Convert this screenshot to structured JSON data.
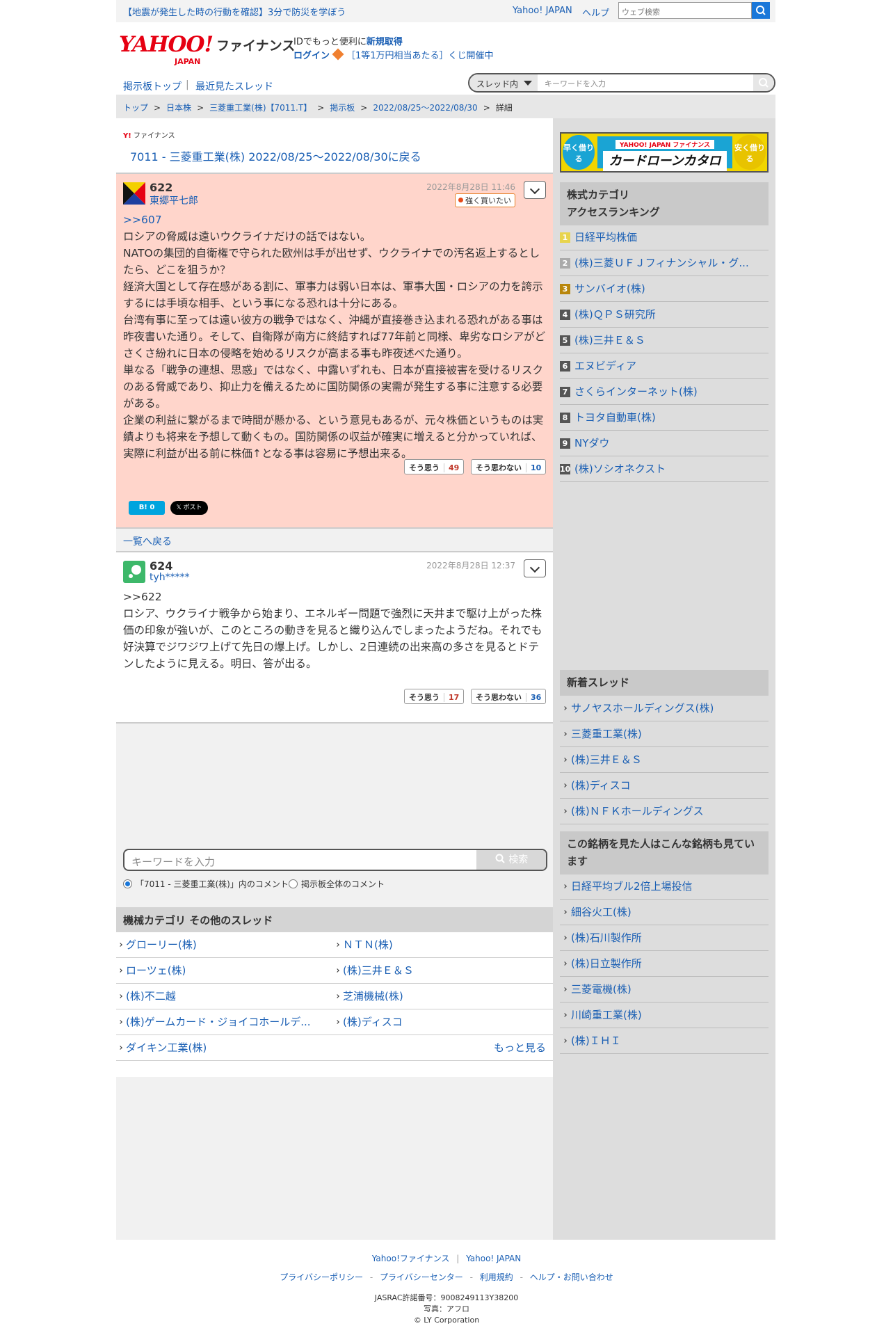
{
  "top": {
    "alert": "【地震が発生した時の行動を確認】3分で防災を学ぼう",
    "yahoo_japan": "Yahoo! JAPAN",
    "help": "ヘルプ",
    "web_search_placeholder": "ウェブ検索"
  },
  "header": {
    "logo": "YAHOO!",
    "logo_sub": "JAPAN",
    "service": "ファイナンス",
    "id_text": "IDでもっと便利に",
    "id_link": "新規取得",
    "login": "ログイン",
    "lottery": "［1等1万円相当あたる］くじ開催中"
  },
  "boardnav": {
    "top": "掲示板トップ",
    "sep": "|",
    "recent": "最近見たスレッド",
    "scope": "スレッド内",
    "keyword_placeholder": "キーワードを入力"
  },
  "breadcrumb": [
    "トップ",
    "日本株",
    "三菱重工業(株)【7011.T】",
    "掲示板",
    "2022/08/25〜2022/08/30",
    "詳細"
  ],
  "thread": {
    "small_logo": "ファイナンス",
    "back": "7011 - 三菱重工業(株) 2022/08/25〜2022/08/30に戻る"
  },
  "posts": [
    {
      "number": "622",
      "user": "東郷平七郎",
      "date": "2022年8月28日 11:46",
      "badge": "強く買いたい",
      "reply": ">>607",
      "lines": [
        "ロシアの脅威は遠いウクライナだけの話ではない。",
        "NATOの集団的自衛権で守られた欧州は手が出せず、ウクライナでの汚名返上するとしたら、どこを狙うか？",
        "経済大国として存在感がある割に、軍事力は弱い日本は、軍事大国・ロシアの力を誇示するには手頃な相手、という事になる恐れは十分にある。",
        "台湾有事に至っては遠い彼方の戦争ではなく、沖縄が直接巻き込まれる恐れがある事は昨夜書いた通り。そして、自衛隊が南方に終結すれば77年前と同様、卑劣なロシアがどさくさ紛れに日本の侵略を始めるリスクが高まる事も昨夜述べた通り。",
        "単なる「戦争の連想、思惑」ではなく、中露いずれも、日本が直接被害を受けるリスクのある脅威であり、抑止力を備えるために国防関係の実需が発生する事に注意する必要がある。",
        "企業の利益に繋がるまで時間が懸かる、という意見もあるが、元々株価というものは実績よりも将来を予想して動くもの。国防関係の収益が確実に増えると分かっていれば、実際に利益が出る前に株価↑となる事は容易に予想出来る。"
      ],
      "agree_label": "そう思う",
      "agree": "49",
      "disagree_label": "そう思わない",
      "disagree": "10",
      "hatena": "B! 0",
      "tweet": "𝕏 ポスト"
    },
    {
      "number": "624",
      "user": "tyh*****",
      "date": "2022年8月28日 12:37",
      "reply": ">>622",
      "lines": [
        "ロシア、ウクライナ戦争から始まり、エネルギー問題で強烈に天井まで駆け上がった株価の印象が強いが、このところの動きを見ると織り込んでしまったようだね。それでも好決算でジワジワ上げて先日の爆上げ。しかし、2日連続の出来高の多さを見るとドテンしたように見える。明日、答が出る。"
      ],
      "agree_label": "そう思う",
      "agree": "17",
      "disagree_label": "そう思わない",
      "disagree": "36"
    }
  ],
  "list_back": "一覧へ戻る",
  "bottom_search": {
    "placeholder": "キーワードを入力",
    "button": "検索",
    "radio1": "「7011 - 三菱重工業(株)」内のコメント",
    "radio2": "掲示板全体のコメント"
  },
  "other_threads": {
    "title": "機械カテゴリ  その他のスレッド",
    "items": [
      "グローリー(株)",
      "ＮＴＮ(株)",
      "ローツェ(株)",
      "(株)三井Ｅ＆Ｓ",
      "(株)不二越",
      "芝浦機械(株)",
      "(株)ゲームカード・ジョイコホールデ...",
      "(株)ディスコ",
      "ダイキン工業(株)"
    ],
    "more": "もっと見る"
  },
  "sidebar": {
    "ad": {
      "left": "早く借りる",
      "brand": "YAHOO! JAPAN ファイナンス",
      "title": "カードローンカタログ",
      "right": "安く借りる"
    },
    "ranking_title_1": "株式カテゴリ",
    "ranking_title_2": "アクセスランキング",
    "ranking": [
      "日経平均株価",
      "(株)三菱ＵＦＪフィナンシャル・グ...",
      "サンバイオ(株)",
      "(株)ＱＰＳ研究所",
      "(株)三井Ｅ＆Ｓ",
      "エヌビディア",
      "さくらインターネット(株)",
      "トヨタ自動車(株)",
      "NYダウ",
      "(株)ソシオネクスト"
    ],
    "new_title": "新着スレッド",
    "new_threads": [
      "サノヤスホールディングス(株)",
      "三菱重工業(株)",
      "(株)三井Ｅ＆Ｓ",
      "(株)ディスコ",
      "(株)ＮＦＫホールディングス"
    ],
    "also_title": "この銘柄を見た人はこんな銘柄も見ています",
    "also": [
      "日経平均ブル2倍上場投信",
      "細谷火工(株)",
      "(株)石川製作所",
      "(株)日立製作所",
      "三菱電機(株)",
      "川崎重工業(株)",
      "(株)ＩＨＩ"
    ]
  },
  "footer": {
    "finance": "Yahoo!ファイナンス",
    "japan": "Yahoo! JAPAN",
    "privacy_policy": "プライバシーポリシー",
    "privacy_center": "プライバシーセンター",
    "terms": "利用規約",
    "help": "ヘルプ・お問い合わせ",
    "jasrac": "JASRAC許諾番号：9008249113Y38200",
    "photo": "写真：アフロ",
    "copyright": "© LY Corporation"
  },
  "colors": {
    "accent": "#1a5fb4",
    "brand_red": "#e60012",
    "post_highlight": "#ffd5cb"
  }
}
